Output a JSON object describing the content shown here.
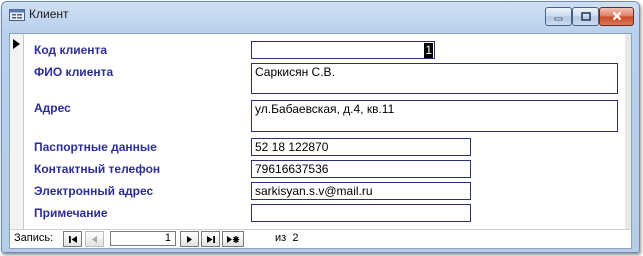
{
  "window": {
    "title": "Клиент",
    "icon": "form-icon",
    "buttons": [
      "minimize-icon",
      "maximize-icon",
      "close-icon"
    ]
  },
  "form": {
    "fields": [
      {
        "label": "Код клиента",
        "value": "1"
      },
      {
        "label": "ФИО клиента",
        "value": "Саркисян С.В."
      },
      {
        "label": "Адрес",
        "value": "ул.Бабаевская, д.4, кв.11"
      },
      {
        "label": "Паспортные данные",
        "value": "52 18 122870"
      },
      {
        "label": "Контактный телефон",
        "value": "79616637536"
      },
      {
        "label": "Электронный адрес",
        "value": "sarkisyan.s.v@mail.ru"
      },
      {
        "label": "Примечание",
        "value": ""
      }
    ]
  },
  "navigation": {
    "caption": "Запись:",
    "current_record": "1",
    "of_label": "из",
    "total_records": "2",
    "buttons": [
      "first-record-icon",
      "previous-record-icon",
      "next-record-icon",
      "last-record-icon",
      "new-record-icon"
    ]
  }
}
